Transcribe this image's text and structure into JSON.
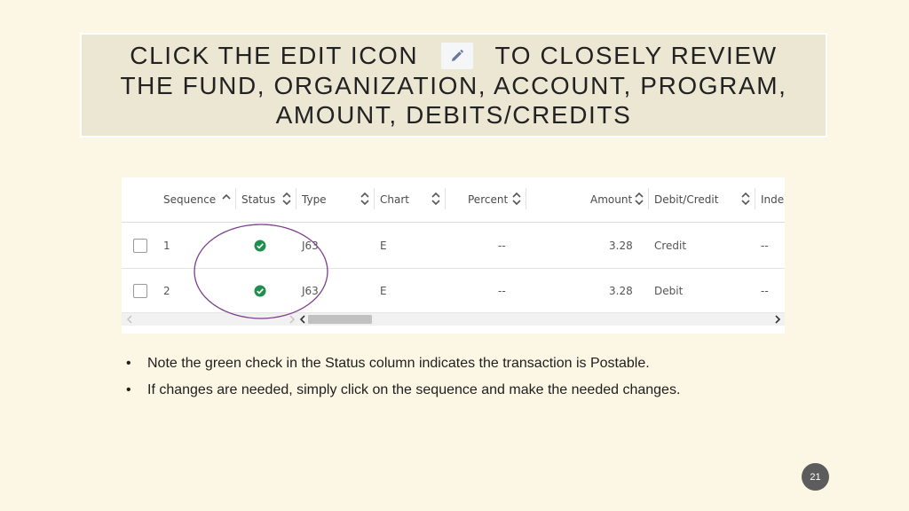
{
  "slide": {
    "title_part1": "CLICK THE EDIT ICON",
    "title_part2": "TO CLOSELY REVIEW",
    "title_line2": "THE FUND, ORGANIZATION, ACCOUNT, PROGRAM,",
    "title_line3": "AMOUNT, DEBITS/CREDITS",
    "edit_icon": "pencil-icon",
    "page_number": "21",
    "annotation_color": "#7b3f8c"
  },
  "table": {
    "headers": {
      "sequence": "Sequence",
      "status": "Status",
      "type": "Type",
      "chart": "Chart",
      "percent": "Percent",
      "amount": "Amount",
      "debit_credit": "Debit/Credit",
      "index": "Inde"
    },
    "rows": [
      {
        "sequence": "1",
        "status": "check-icon",
        "type": "J63",
        "chart": "E",
        "percent": "--",
        "amount": "3.28",
        "debit_credit": "Credit",
        "index": "--"
      },
      {
        "sequence": "2",
        "status": "check-icon",
        "type": "J63",
        "chart": "E",
        "percent": "--",
        "amount": "3.28",
        "debit_credit": "Debit",
        "index": "--"
      }
    ],
    "status_color": "#1f8f4e"
  },
  "bullets": [
    "Note the green check in the Status column indicates the transaction is Postable.",
    "If changes are needed, simply click on the sequence and make the needed changes."
  ]
}
